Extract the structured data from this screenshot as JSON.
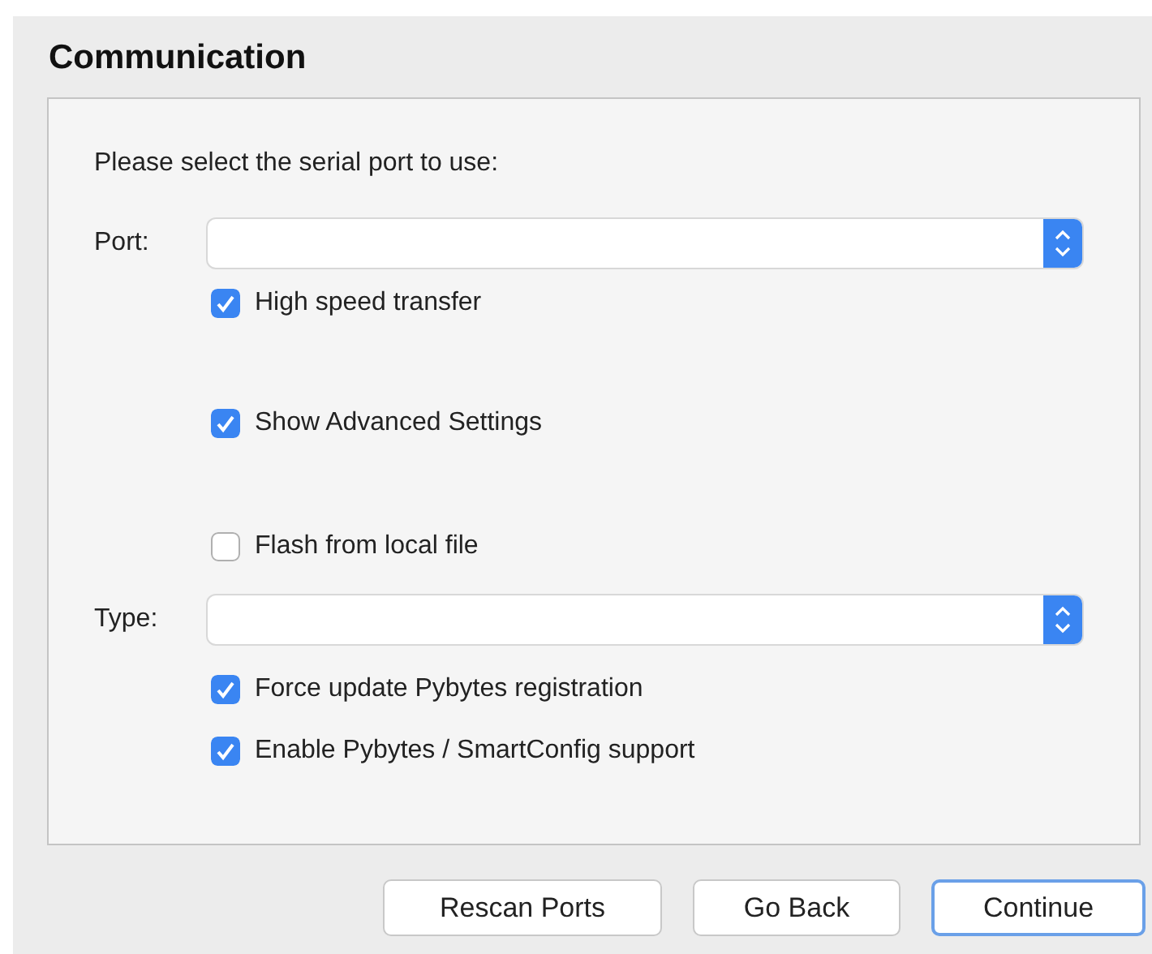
{
  "title": "Communication",
  "rows": [
    {
      "kind": "text",
      "text": "Please select the serial port to use:"
    },
    {
      "kind": "select",
      "label": "Port:"
    },
    {
      "kind": "checkbox",
      "label": "High speed transfer",
      "checked": true
    },
    {
      "kind": "checkbox",
      "label": "Show Advanced Settings",
      "checked": true
    },
    {
      "kind": "checkbox",
      "label": "Flash from local file",
      "checked": false
    },
    {
      "kind": "select",
      "label": "Type:"
    },
    {
      "kind": "checkbox",
      "label": "Force update Pybytes registration",
      "checked": true
    },
    {
      "kind": "checkbox",
      "label": "Enable Pybytes / SmartConfig support",
      "checked": true
    }
  ],
  "buttons": [
    {
      "label": "Rescan Ports",
      "focused": false
    },
    {
      "label": "Go Back",
      "focused": false
    },
    {
      "label": "Continue",
      "focused": true
    }
  ]
}
